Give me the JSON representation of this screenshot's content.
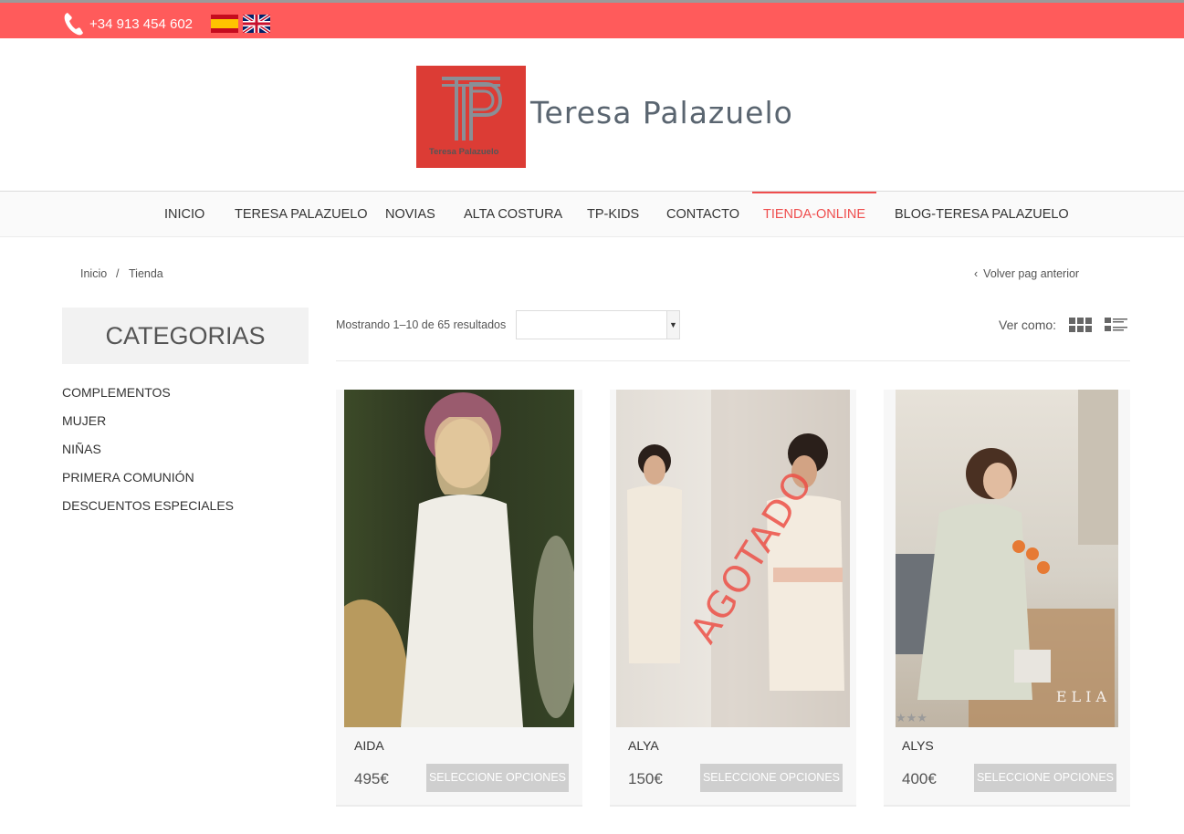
{
  "topbar": {
    "phone": "+34 913 454 602",
    "colors": {
      "bar": "#ff5b5b"
    }
  },
  "logo": {
    "brand_name": "Teresa Palazuelo",
    "mark_caption": "Teresa Palazuelo",
    "color": "#dc3c35"
  },
  "nav": {
    "items": [
      "INICIO",
      "TERESA PALAZUELO",
      "NOVIAS",
      "ALTA COSTURA",
      "TP-KIDS",
      "CONTACTO",
      "TIENDA-ONLINE",
      "BLOG-TERESA PALAZUELO"
    ],
    "active": "TIENDA-ONLINE",
    "accent": "#ef4e4e"
  },
  "breadcrumb": {
    "home": "Inicio",
    "separator": "/",
    "current": "Tienda",
    "back": "Volver pag anterior"
  },
  "sidebar": {
    "title": "CATEGORIAS",
    "items": [
      "COMPLEMENTOS",
      "MUJER",
      "NIÑAS",
      "PRIMERA COMUNIÓN",
      "DESCUENTOS ESPECIALES"
    ]
  },
  "toolbar": {
    "results": "Mostrando 1–10 de 65 resultados",
    "sort_value": "",
    "view_label": "Ver como:"
  },
  "products": [
    {
      "name": "AIDA",
      "price": "495€",
      "button": "SELECCIONE OPCIONES"
    },
    {
      "name": "ALYA",
      "price": "150€",
      "button": "SELECCIONE OPCIONES",
      "badge": "AGOTADO"
    },
    {
      "name": "ALYS",
      "price": "400€",
      "button": "SELECCIONE OPCIONES",
      "photo_caption": "ELIA"
    }
  ]
}
